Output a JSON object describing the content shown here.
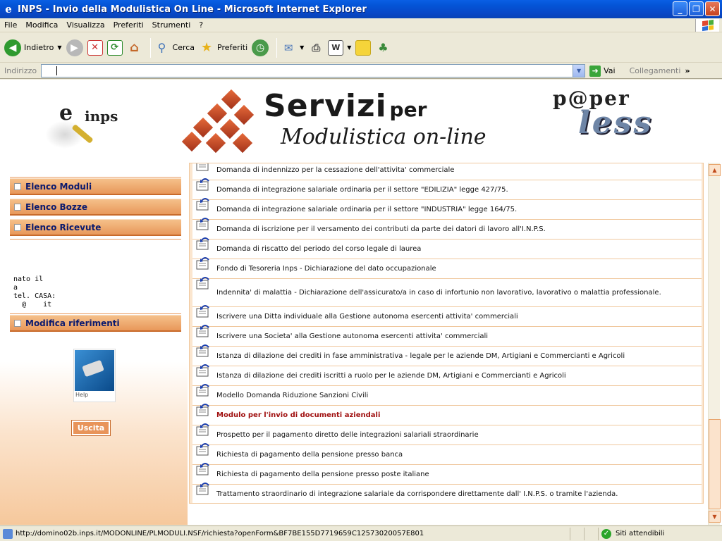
{
  "window": {
    "title": "INPS - Invio della Modulistica On Line - Microsoft Internet Explorer",
    "controls": {
      "minimize": "_",
      "maximize": "❐",
      "close": "✕"
    }
  },
  "menu": [
    "File",
    "Modifica",
    "Visualizza",
    "Preferiti",
    "Strumenti",
    "?"
  ],
  "toolbar": {
    "back_label": "Indietro",
    "search_label": "Cerca",
    "favorites_label": "Preferiti"
  },
  "address": {
    "label": "Indirizzo",
    "value": "",
    "go_label": "Vai",
    "links_label": "Collegamenti",
    "chevron": "»"
  },
  "header": {
    "logo_e": "e",
    "logo_inps": "inps",
    "servizi_big": "Servizi",
    "servizi_per": "per",
    "modulistica": "Modulistica on-line",
    "paper_top": "p@per",
    "paper_bottom": "less"
  },
  "nav": {
    "items": [
      "Elenco Moduli",
      "Elenco Bozze",
      "Elenco Ricevute"
    ],
    "user_lines": [
      "nato il",
      "a",
      "tel. CASA:",
      "  @    it"
    ],
    "modifica_label": "Modifica riferimenti",
    "help_caption": "Help",
    "uscita_label": "Uscita"
  },
  "list": {
    "items": [
      "Domanda di indennizzo per la cessazione dell'attivita' commerciale",
      "Domanda di integrazione salariale ordinaria per il settore \"EDILIZIA\" legge 427/75.",
      "Domanda di integrazione salariale ordinaria per il settore \"INDUSTRIA\" legge 164/75.",
      "Domanda di iscrizione per il versamento dei contributi da parte dei datori di lavoro all'I.N.P.S.",
      "Domanda di riscatto del periodo del corso legale di laurea",
      "Fondo di Tesoreria Inps - Dichiarazione del dato occupazionale",
      "Indennita' di malattia - Dichiarazione dell'assicurato/a in caso di infortunio non lavorativo, lavorativo o malattia professionale.",
      "Iscrivere una Ditta individuale alla Gestione autonoma esercenti attivita' commerciali",
      "Iscrivere una Societa' alla Gestione autonoma esercenti attivita' commerciali",
      "Istanza di dilazione dei crediti in fase amministrativa - legale per le aziende DM, Artigiani e Commercianti e Agricoli",
      "Istanza di dilazione dei crediti iscritti a ruolo per le aziende DM, Artigiani e Commercianti e Agricoli",
      "Modello Domanda Riduzione Sanzioni Civili",
      "Modulo per l'invio di documenti aziendali",
      "Prospetto per il pagamento diretto delle integrazioni salariali straordinarie",
      "Richiesta di pagamento della pensione presso banca",
      "Richiesta di pagamento della pensione presso poste italiane",
      "Trattamento straordinario di integrazione salariale da corrispondere direttamente dall' I.N.P.S. o tramite l'azienda."
    ],
    "highlighted": "Modulo per l'invio di documenti aziendali"
  },
  "status": {
    "url": "http://domino02b.inps.it/MODONLINE/PLMODULI.NSF/richiesta?openForm&BF7BE155D7719659C12573020057E801",
    "zone": "Siti attendibili"
  },
  "colors": {
    "accent": "#e8985a",
    "nav_text": "#0b1a6e",
    "highlight_text": "#a01010",
    "titlebar": "#0454d6"
  }
}
